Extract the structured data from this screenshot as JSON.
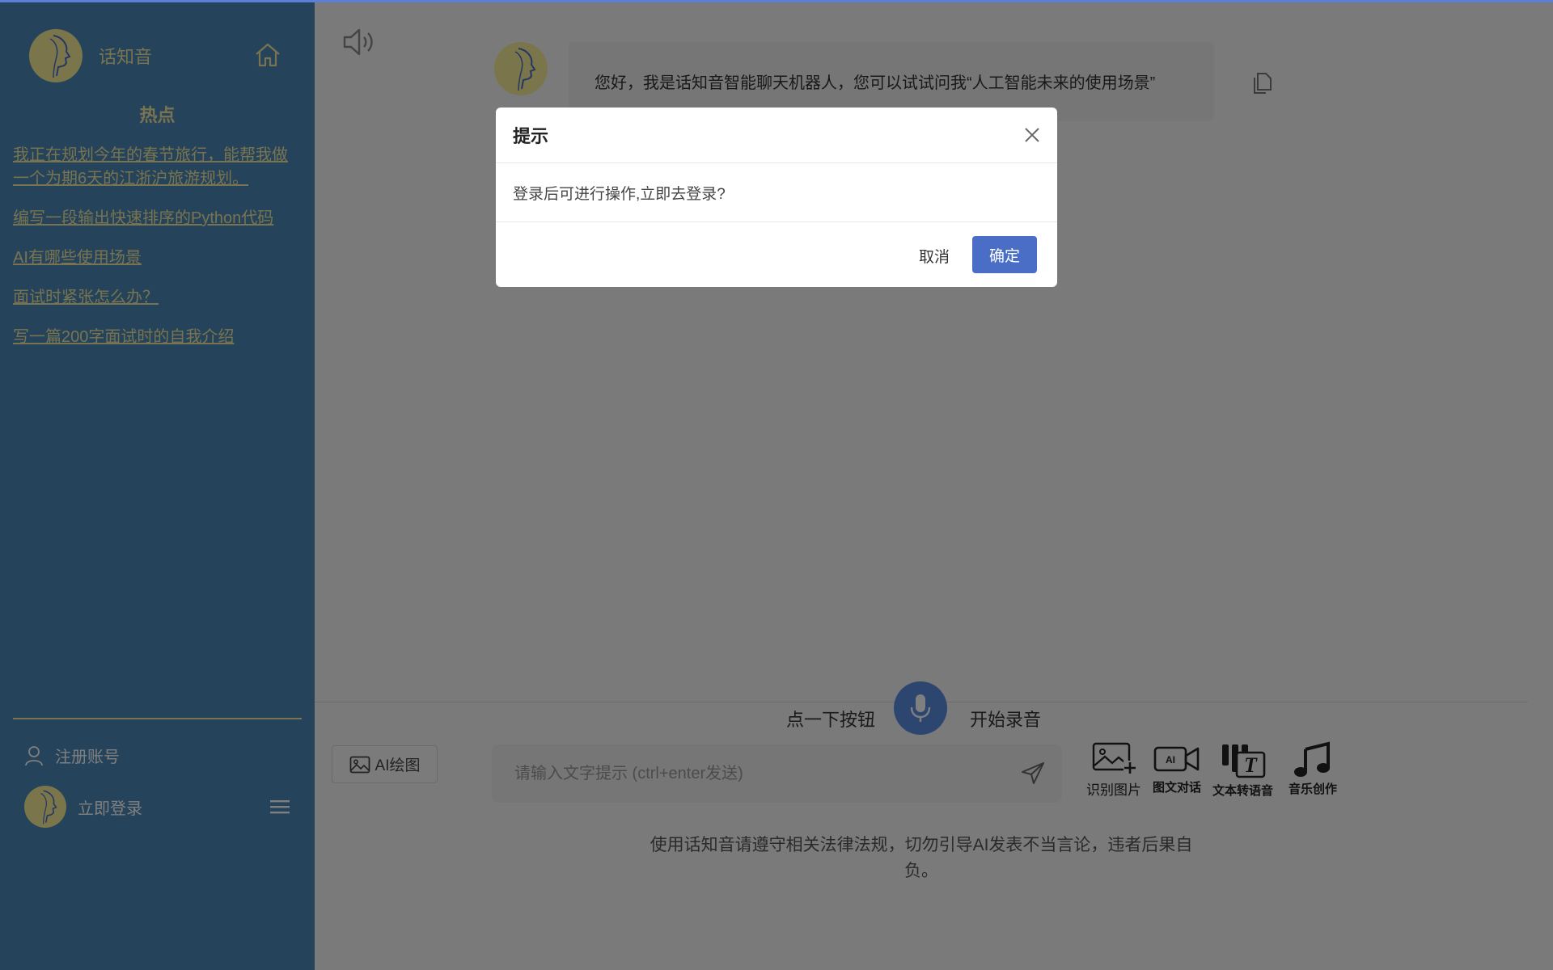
{
  "app": {
    "name": "话知音"
  },
  "sidebar": {
    "hot_title": "热点",
    "hot_items": [
      "我正在规划今年的春节旅行，能帮我做一个为期6天的江浙沪旅游规划。",
      "编写一段输出快速排序的Python代码",
      "AI有哪些使用场景",
      "面试时紧张怎么办？",
      "写一篇200字面试时的自我介绍"
    ],
    "register_label": "注册账号",
    "login_label": "立即登录"
  },
  "chat": {
    "bot_message": "您好，我是话知音智能聊天机器人，您可以试试问我“人工智能未来的使用场景”"
  },
  "recorder": {
    "left_text": "点一下按钮",
    "right_text": "开始录音"
  },
  "toolbar": {
    "ai_draw_label": "AI绘图",
    "input_placeholder": "请输入文字提示 (ctrl+enter发送)",
    "tools": [
      {
        "label": "识别图片",
        "icon": "image-plus-icon"
      },
      {
        "label": "图文对话",
        "icon": "ai-video-icon"
      },
      {
        "label": "文本转语音",
        "icon": "text-to-speech-icon"
      },
      {
        "label": "音乐创作",
        "icon": "music-note-icon"
      }
    ]
  },
  "disclaimer": "使用话知音请遵守相关法律法规，切勿引导AI发表不当言论，违者后果自负。",
  "modal": {
    "title": "提示",
    "message": "登录后可进行操作,立即去登录?",
    "cancel_label": "取消",
    "confirm_label": "确定"
  },
  "colors": {
    "sidebar_bg": "#4a87b5",
    "accent_text": "#f1e7a0",
    "primary_button": "#4a6ec6",
    "mic_button": "#5b8de0"
  }
}
